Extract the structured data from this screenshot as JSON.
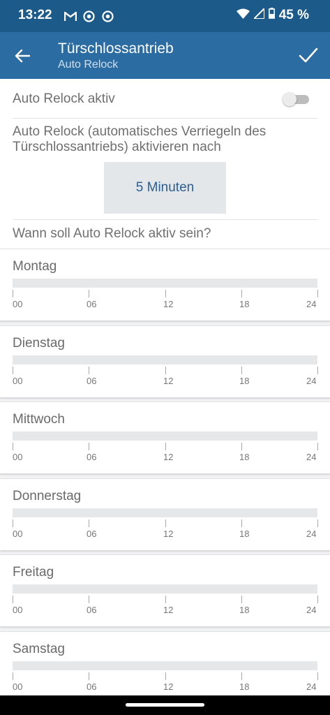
{
  "status_bar": {
    "time": "13:22",
    "notifications": [
      "gmail-icon",
      "chrome-icon",
      "chrome-icon"
    ],
    "battery": "45 %"
  },
  "header": {
    "title": "Türschlossantrieb",
    "subtitle": "Auto Relock",
    "back_icon": "arrow-left-icon",
    "confirm_icon": "checkmark-icon"
  },
  "auto_relock": {
    "label": "Auto Relock aktiv",
    "enabled": false,
    "description": "Auto Relock (automatisches Verriegeln des Türschlossantriebs) aktivieren nach",
    "duration_button": "5 Minuten"
  },
  "schedule": {
    "question": "Wann soll Auto Relock aktiv sein?",
    "tick_labels": [
      "00",
      "06",
      "12",
      "18",
      "24"
    ],
    "days": [
      {
        "name": "Montag"
      },
      {
        "name": "Dienstag"
      },
      {
        "name": "Mittwoch"
      },
      {
        "name": "Donnerstag"
      },
      {
        "name": "Freitag"
      },
      {
        "name": "Samstag"
      }
    ]
  },
  "colors": {
    "status_bar": "#1c5a8a",
    "app_bar": "#2b6ca3",
    "accent_text": "#2a5f8e"
  }
}
